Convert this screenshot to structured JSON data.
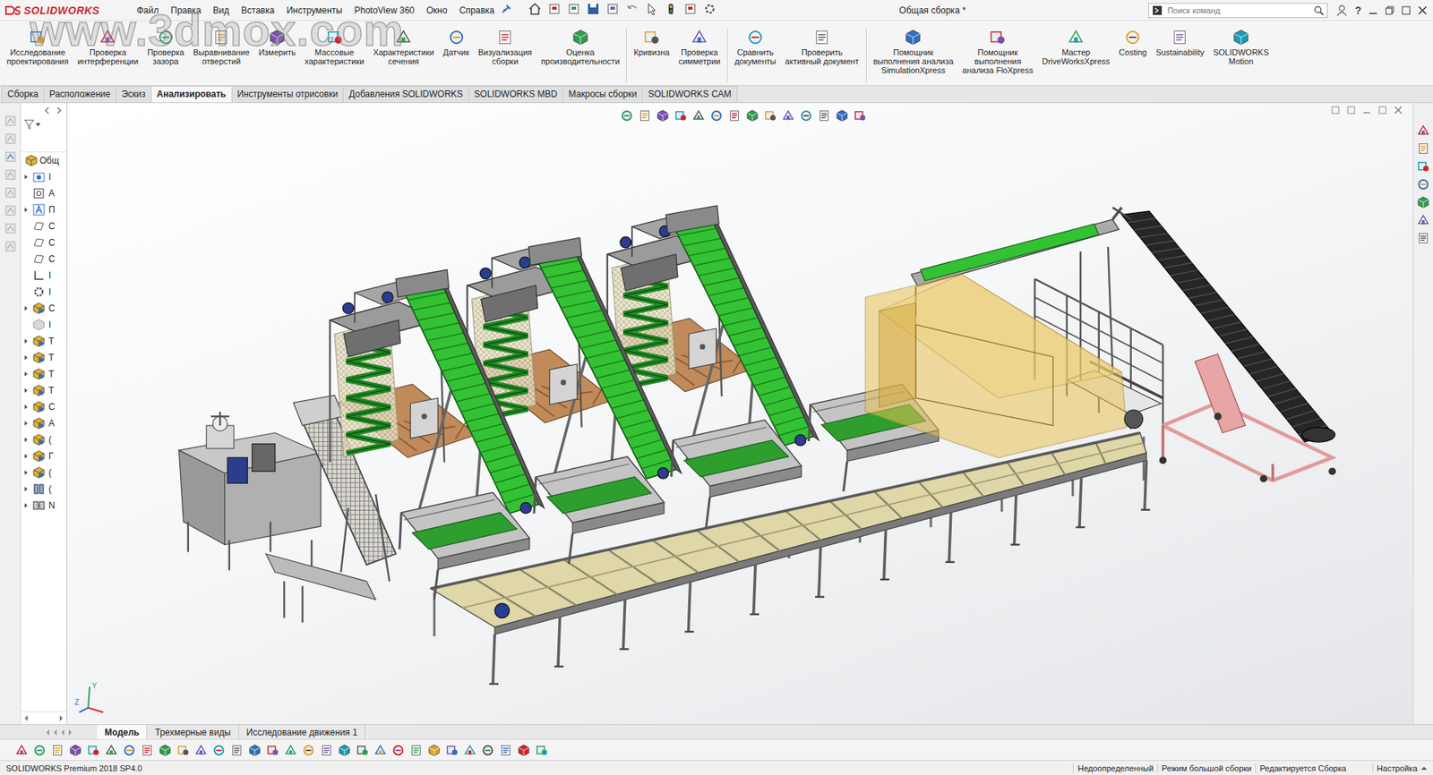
{
  "window": {
    "title": "Общая сборка *",
    "app": "SOLIDWORKS",
    "help": "?"
  },
  "watermark": "www.3dmox.com",
  "menu": [
    "Файл",
    "Правка",
    "Вид",
    "Вставка",
    "Инструменты",
    "PhotoView 360",
    "Окно",
    "Справка"
  ],
  "search": {
    "placeholder": "Поиск команд"
  },
  "ribbon": {
    "groups": [
      [
        "Исследование\nпроектирования",
        "Проверка\nинтерференции",
        "Проверка\nзазора",
        "Выравнивание\nотверстий",
        "Измерить",
        "Массовые\nхарактеристики",
        "Характеристики\nсечения",
        "Датчик",
        "Визуализация\nсборки",
        "Оценка\nпроизводительности"
      ],
      [
        "Кривизна",
        "Проверка\nсимметрии"
      ],
      [
        "Сравнить\nдокументы",
        "Проверить\nактивный документ"
      ],
      [
        "Помощник\nвыполнения анализа\nSimulationXpress",
        "Помощник\nвыполнения\nанализа FloXpress",
        "Мастер\nDriveWorksXpress",
        "Costing",
        "Sustainability",
        "SOLIDWORKS\nMotion"
      ]
    ]
  },
  "tabs": [
    {
      "label": "Сборка",
      "selected": false
    },
    {
      "label": "Расположение",
      "selected": false
    },
    {
      "label": "Эскиз",
      "selected": false
    },
    {
      "label": "Анализировать",
      "selected": true
    },
    {
      "label": "Инструменты отрисовки",
      "selected": false
    },
    {
      "label": "Добавления SOLIDWORKS",
      "selected": false
    },
    {
      "label": "SOLIDWORKS MBD",
      "selected": false
    },
    {
      "label": "Макросы сборки",
      "selected": false
    },
    {
      "label": "SOLIDWORKS CAM",
      "selected": false
    }
  ],
  "tree": {
    "root": "Общ",
    "items": [
      {
        "label": "I",
        "kind": "folder",
        "has_children": true
      },
      {
        "label": "A",
        "kind": "sensor",
        "has_children": false
      },
      {
        "label": "П",
        "kind": "annotation",
        "has_children": true
      },
      {
        "label": "С",
        "kind": "plane",
        "has_children": false
      },
      {
        "label": "С",
        "kind": "plane",
        "has_children": false
      },
      {
        "label": "С",
        "kind": "plane",
        "has_children": false
      },
      {
        "label": "I",
        "kind": "origin",
        "has_children": false
      },
      {
        "label": "I",
        "kind": "gear",
        "has_children": false
      },
      {
        "label": "С",
        "kind": "assembly",
        "has_children": true
      },
      {
        "label": "I",
        "kind": "part",
        "has_children": false
      },
      {
        "label": "T",
        "kind": "assembly",
        "has_children": true
      },
      {
        "label": "T",
        "kind": "assembly",
        "has_children": true
      },
      {
        "label": "T",
        "kind": "assembly",
        "has_children": true
      },
      {
        "label": "T",
        "kind": "assembly",
        "has_children": true
      },
      {
        "label": "C",
        "kind": "assembly",
        "has_children": true
      },
      {
        "label": "A",
        "kind": "assembly",
        "has_children": true
      },
      {
        "label": "(",
        "kind": "assembly",
        "has_children": true
      },
      {
        "label": "Г",
        "kind": "assembly",
        "has_children": true
      },
      {
        "label": "(",
        "kind": "assembly",
        "has_children": true
      },
      {
        "label": "(",
        "kind": "pattern",
        "has_children": true
      },
      {
        "label": "N",
        "kind": "mates",
        "has_children": true
      }
    ]
  },
  "bottom_tabs": [
    {
      "label": "Модель",
      "selected": true
    },
    {
      "label": "Трехмерные виды",
      "selected": false
    },
    {
      "label": "Исследование движения 1",
      "selected": false
    }
  ],
  "axes": {
    "y": "Y",
    "z": "Z"
  },
  "status_bar": {
    "product": "SOLIDWORKS Premium 2018 SP4.0",
    "items": [
      "Недоопределенный",
      "Режим большой сборки",
      "Редактируется Сборка",
      "Настройка"
    ]
  }
}
